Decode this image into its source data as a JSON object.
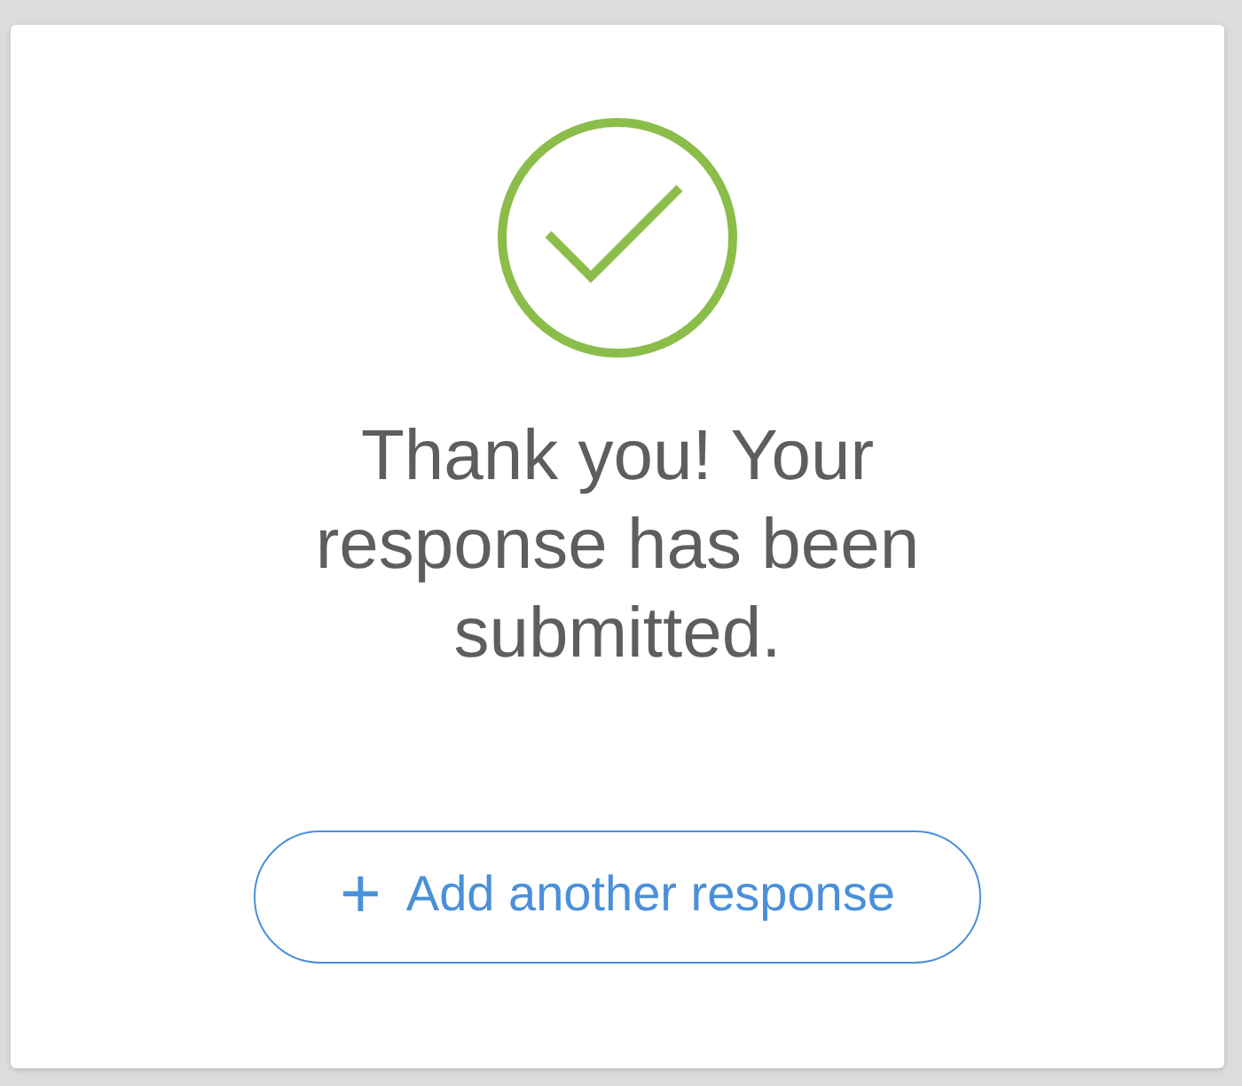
{
  "message": "Thank you! Your response has been submitted.",
  "button": {
    "icon": "+",
    "label": "Add another response"
  }
}
